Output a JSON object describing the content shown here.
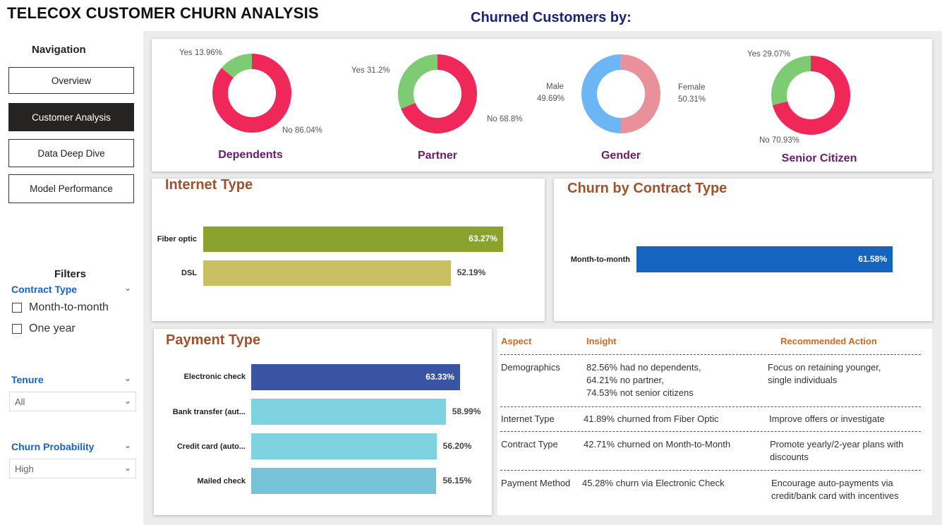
{
  "header": {
    "title": "TELECOX CUSTOMER CHURN ANALYSIS",
    "subtitle": "Churned Customers by:"
  },
  "navigation": {
    "title": "Navigation",
    "items": [
      "Overview",
      "Customer Analysis",
      "Data Deep Dive",
      "Model Performance"
    ],
    "active": "Customer Analysis"
  },
  "filters": {
    "title": "Filters",
    "contract_type": {
      "label": "Contract Type",
      "options": [
        "Month-to-month",
        "One year"
      ]
    },
    "tenure": {
      "label": "Tenure",
      "value": "All"
    },
    "churn_probability": {
      "label": "Churn Probability",
      "value": "High"
    }
  },
  "donuts": [
    {
      "title": "Dependents",
      "slices": [
        {
          "label": "Yes 13.96%",
          "value": 13.96,
          "color": "#7dcc74"
        },
        {
          "label": "No 86.04%",
          "value": 86.04,
          "color": "#f0285a"
        }
      ]
    },
    {
      "title": "Partner",
      "slices": [
        {
          "label": "Yes 31.2%",
          "value": 31.2,
          "color": "#7dcc74"
        },
        {
          "label": "No 68.8%",
          "value": 68.8,
          "color": "#f0285a"
        }
      ]
    },
    {
      "title": "Gender",
      "slices": [
        {
          "label": "Male",
          "value": 49.69,
          "pct": "49.69%",
          "color": "#6db6f5"
        },
        {
          "label": "Female",
          "value": 50.31,
          "pct": "50.31%",
          "color": "#e8919a"
        }
      ]
    },
    {
      "title": "Senior Citizen",
      "slices": [
        {
          "label": "Yes 29.07%",
          "value": 29.07,
          "color": "#7dcc74"
        },
        {
          "label": "No 70.93%",
          "value": 70.93,
          "color": "#f0285a"
        }
      ]
    }
  ],
  "internet_type": {
    "title": "Internet Type",
    "bars": [
      {
        "category": "Fiber optic",
        "value": 63.27,
        "label": "63.27%",
        "color": "#8ba22e"
      },
      {
        "category": "DSL",
        "value": 52.19,
        "label": "52.19%",
        "color": "#c9bf63"
      }
    ]
  },
  "contract_type": {
    "title": "Churn by Contract Type",
    "bars": [
      {
        "category": "Month-to-month",
        "value": 61.58,
        "label": "61.58%",
        "color": "#1565c0"
      }
    ]
  },
  "payment_type": {
    "title": "Payment Type",
    "bars": [
      {
        "category": "Electronic check",
        "value": 63.33,
        "label": "63.33%",
        "color": "#3a54a4"
      },
      {
        "category": "Bank transfer (aut...",
        "value": 58.99,
        "label": "58.99%",
        "color": "#7fd3e0"
      },
      {
        "category": "Credit card (auto...",
        "value": 56.2,
        "label": "56.20%",
        "color": "#7fd3e0"
      },
      {
        "category": "Mailed check",
        "value": 56.15,
        "label": "56.15%",
        "color": "#76c3d8"
      }
    ]
  },
  "insights": {
    "headers": [
      "Aspect",
      "Insight",
      "Recommended Action"
    ],
    "rows": [
      {
        "aspect": "Demographics",
        "insight": [
          "82.56% had no dependents,",
          "64.21% no partner,",
          "74.53% not senior citizens"
        ],
        "action": [
          "Focus on retaining younger,",
          "single individuals"
        ]
      },
      {
        "aspect": "Internet Type",
        "insight": [
          "41.89% churned from Fiber Optic"
        ],
        "action": [
          "Improve offers or investigate"
        ]
      },
      {
        "aspect": "Contract Type",
        "insight": [
          "42.71% churned on Month-to-Month"
        ],
        "action": [
          "Promote yearly/2-year plans with",
          "discounts"
        ]
      },
      {
        "aspect": "Payment Method",
        "insight": [
          "45.28% churn via Electronic Check"
        ],
        "action": [
          "Encourage auto-payments via",
          "credit/bank card with incentives"
        ]
      }
    ]
  }
}
